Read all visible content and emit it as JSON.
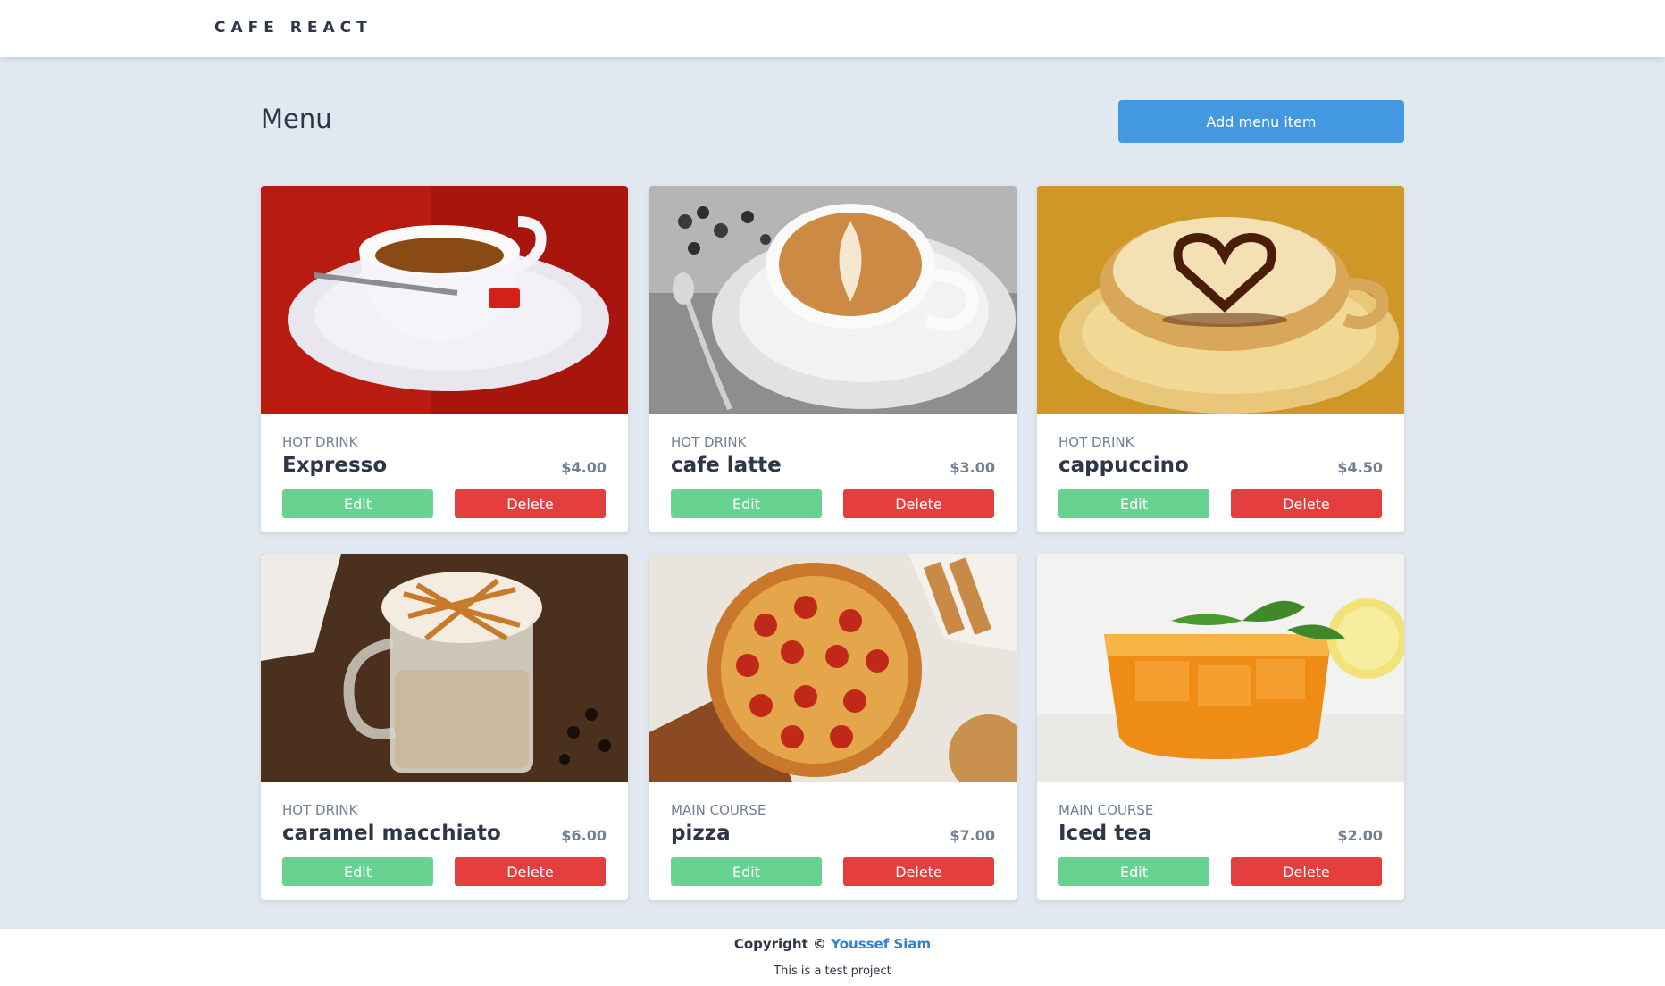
{
  "app": {
    "brand": "CAFE REACT"
  },
  "page": {
    "title": "Menu",
    "add_label": "Add menu item"
  },
  "items": [
    {
      "category": "HOT DRINK",
      "name": "Expresso",
      "price": "$4.00",
      "image": "espresso-cup-image"
    },
    {
      "category": "HOT DRINK",
      "name": "cafe latte",
      "price": "$3.00",
      "image": "latte-art-cup-image"
    },
    {
      "category": "HOT DRINK",
      "name": "cappuccino",
      "price": "$4.50",
      "image": "cappuccino-heart-image"
    },
    {
      "category": "HOT DRINK",
      "name": "caramel macchiato",
      "price": "$6.00",
      "image": "caramel-macchiato-image"
    },
    {
      "category": "MAIN COURSE",
      "name": "pizza",
      "price": "$7.00",
      "image": "pepperoni-pizza-image"
    },
    {
      "category": "MAIN COURSE",
      "name": "Iced tea",
      "price": "$2.00",
      "image": "iced-tea-glass-image"
    }
  ],
  "actions": {
    "edit_label": "Edit",
    "delete_label": "Delete"
  },
  "footer": {
    "copyright_prefix": "Copyright ©",
    "author": "Youssef Siam",
    "note": "This is a test project"
  },
  "colors": {
    "accent": "#4299e1",
    "edit": "#68d391",
    "delete": "#e53e3e",
    "background": "#e2e8f0",
    "link": "#3182ce"
  }
}
